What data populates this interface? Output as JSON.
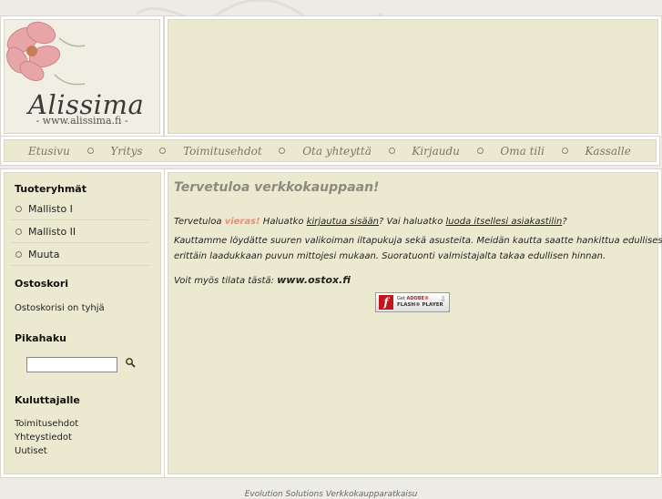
{
  "logo": {
    "brand": "Alissima",
    "url": "- www.alissima.fi -"
  },
  "nav": {
    "items": [
      "Etusivu",
      "Yritys",
      "Toimitusehdot",
      "Ota yhteyttä",
      "Kirjaudu",
      "Oma tili",
      "Kassalle"
    ]
  },
  "sidebar": {
    "product_groups_title": "Tuoteryhmät",
    "product_groups": [
      "Mallisto I",
      "Mallisto II",
      "Muuta"
    ],
    "cart_title": "Ostoskori",
    "cart_text": "Ostoskorisi on tyhjä",
    "quick_search_title": "Pikahaku",
    "consumer_title": "Kuluttajalle",
    "consumer_links": [
      "Toimitusehdot",
      "Yhteystiedot",
      "Uutiset"
    ]
  },
  "main": {
    "title": "Tervetuloa verkkokauppaan!",
    "welcome": "Tervetuloa",
    "guest": "vieras!",
    "q1": "Haluatko",
    "login_link": "kirjautua sisään",
    "q2": "? Vai haluatko",
    "register_link": "luoda itsellesi asiakastilin",
    "q3": "?",
    "intro_line1": "Kauttamme löydätte suuren valikoiman iltapukuja sekä asusteita. Meidän kautta saatte hankittua edullisesti",
    "intro_line2": "erittäin laadukkaan puvun mittojesi mukaan. Suoratuonti valmistajalta takaa edullisen hinnan.",
    "order_text": "Voit myös tilata tästä:",
    "order_link": "www.ostox.fi",
    "flash_get": "Get",
    "flash_adobe": "ADOBE®",
    "flash_player": "FLASH® PLAYER"
  },
  "footer": {
    "text": "Evolution Solutions Verkkokaupparatkaisu"
  }
}
